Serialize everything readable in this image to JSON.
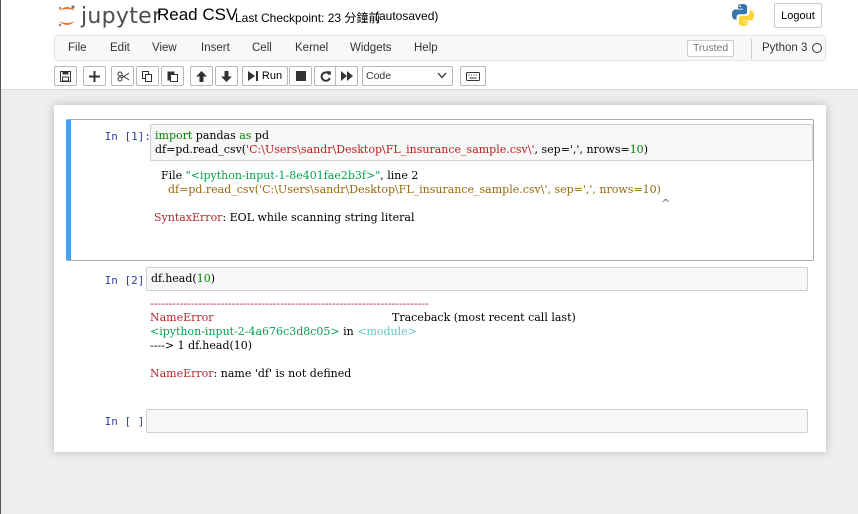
{
  "header": {
    "logo_text": "jupyter",
    "notebook_name": "Read CSV",
    "checkpoint": "Last Checkpoint: 23 分鐘前",
    "autosave": "(autosaved)",
    "logout_label": "Logout"
  },
  "menu": {
    "items": [
      "File",
      "Edit",
      "View",
      "Insert",
      "Cell",
      "Kernel",
      "Widgets",
      "Help"
    ],
    "trusted_label": "Trusted",
    "kernel_name": "Python 3"
  },
  "toolbar": {
    "run_label": "Run",
    "cell_type": "Code"
  },
  "cells": [
    {
      "prompt": "In [1]:",
      "code_line1_kw1": "import",
      "code_line1_mid": " pandas ",
      "code_line1_kw2": "as",
      "code_line1_end": " pd",
      "code_line2_a": "df=pd.read_csv(",
      "code_line2_str": "'C:\\Users\\sandr\\Desktop\\FL_insurance_sample.csv\\'",
      "code_line2_b": ", sep=',', nrows=",
      "code_line2_num": "10",
      "code_line2_c": ")",
      "out_file_a": "  File ",
      "out_file_str": "\"<ipython-input-1-8e401fae2b3f>\"",
      "out_file_b": ", line 2",
      "out_line2": "    df=pd.read_csv('C:\\Users\\sandr\\Desktop\\FL_insurance_sample.csv\\', sep=',', nrows=10)",
      "out_caret": "^",
      "err_name": "SyntaxError",
      "err_msg": ": EOL while scanning string literal"
    },
    {
      "prompt": "In [2]:",
      "code_a": "df.head(",
      "code_num": "10",
      "code_b": ")",
      "dash_line": "---------------------------------------------------------------------------",
      "err_name": "NameError",
      "traceback_label": "Traceback (most recent call last)",
      "tb_input": "<ipython-input-2-4a676c3d8c05>",
      "tb_in": " in ",
      "tb_module": "<module>",
      "tb_arrow": "----> 1 df.head(10)",
      "err_name2": "NameError",
      "err_msg": ": name 'df' is not defined"
    },
    {
      "prompt": "In [ ]:"
    }
  ],
  "colors": {
    "accent": "#42a5f5",
    "prompt": "#303f9f",
    "error_red": "#b22b31",
    "keyword_green": "#008000",
    "string_red": "#ba2121"
  }
}
